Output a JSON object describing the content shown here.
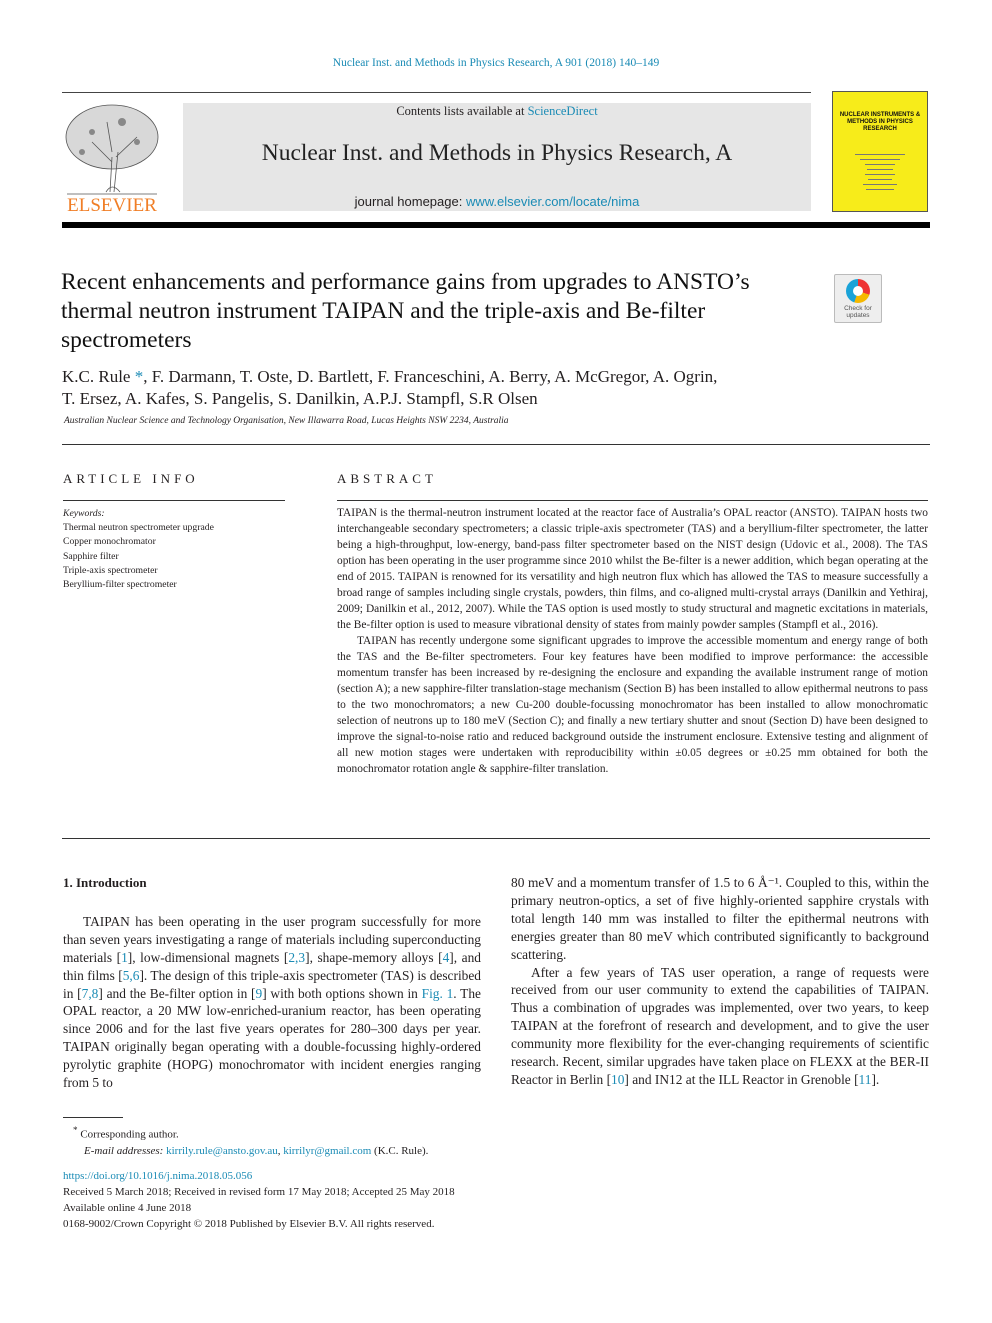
{
  "header": {
    "journal_ref": "Nuclear Inst. and Methods in Physics Research, A 901 (2018) 140–149",
    "contents_prefix": "Contents lists available at ",
    "contents_link": "ScienceDirect",
    "journal_title": "Nuclear Inst. and Methods in Physics Research, A",
    "homepage_prefix": "journal homepage: ",
    "homepage_link": "www.elsevier.com/locate/nima",
    "publisher_logo": "ELSEVIER",
    "cover_title": "NUCLEAR INSTRUMENTS & METHODS IN PHYSICS RESEARCH",
    "check_updates": "Check for updates"
  },
  "article": {
    "title": "Recent enhancements and performance gains from upgrades to ANSTO’s thermal neutron instrument TAIPAN and the triple-axis and Be-filter spectrometers",
    "authors_line1_a": "K.C. Rule ",
    "authors_star": "*",
    "authors_line1_b": ", F. Darmann, T. Oste, D. Bartlett, F. Franceschini, A. Berry, A. McGregor, A. Ogrin,",
    "authors_line2": "T. Ersez, A. Kafes, S. Pangelis, S. Danilkin, A.P.J. Stampfl, S.R Olsen",
    "affiliation": "Australian Nuclear Science and Technology Organisation, New Illawarra Road, Lucas Heights NSW 2234, Australia"
  },
  "article_info": {
    "heading": "ARTICLE INFO",
    "keywords_label": "Keywords:",
    "keywords": [
      "Thermal neutron spectrometer upgrade",
      "Copper monochromator",
      "Sapphire filter",
      "Triple-axis spectrometer",
      "Beryllium-filter spectrometer"
    ]
  },
  "abstract": {
    "heading": "ABSTRACT",
    "paragraphs": [
      "TAIPAN is the thermal-neutron instrument located at the reactor face of Australia’s OPAL reactor (ANSTO). TAIPAN hosts two interchangeable secondary spectrometers; a classic triple-axis spectrometer (TAS) and a beryllium-filter spectrometer, the latter being a high-throughput, low-energy, band-pass filter spectrometer based on the NIST design (Udovic et al., 2008). The TAS option has been operating in the user programme since 2010 whilst the Be-filter is a newer addition, which began operating at the end of 2015.  TAIPAN is renowned for its versatility and high neutron flux which has allowed the TAS to measure successfully a broad range of samples including single crystals, powders, thin films, and co-aligned multi-crystal arrays (Danilkin and Yethiraj, 2009; Danilkin et al., 2012, 2007). While the TAS option is used mostly to study structural and magnetic excitations in materials, the Be-filter option is used to measure vibrational density of states from mainly powder samples (Stampfl et al., 2016).",
      "TAIPAN has recently undergone some significant upgrades to improve the accessible momentum and energy range of both the TAS and the Be-filter spectrometers. Four key features have been modified to improve performance: the accessible momentum transfer has been increased by re-designing the enclosure and expanding the available instrument range of motion (section A); a new sapphire-filter translation-stage mechanism (Section B) has been installed to allow epithermal neutrons to pass to the two monochromators; a new Cu-200 double-focussing monochromator has been installed to allow monochromatic selection of neutrons up to 180 meV (Section C); and finally a new tertiary shutter and snout (Section D) have been designed to improve the signal-to-noise ratio and reduced background outside the instrument enclosure. Extensive testing and alignment of all new motion stages were undertaken with reproducibility within ±0.05 degrees or ±0.25 mm obtained for both the monochromator rotation angle & sapphire-filter translation."
    ]
  },
  "body": {
    "intro_heading": "1.  Introduction",
    "left_paragraphs": [
      [
        "TAIPAN has been operating in the user program successfully for more than seven years investigating a range of materials including superconducting materials [",
        {
          "link": "1"
        },
        "], low-dimensional magnets [",
        {
          "link": "2,3"
        },
        "], shape-memory alloys [",
        {
          "link": "4"
        },
        "], and thin films [",
        {
          "link": "5,6"
        },
        "]. The design of this triple-axis spectrometer (TAS) is described in [",
        {
          "link": "7,8"
        },
        "] and the Be-filter option in [",
        {
          "link": "9"
        },
        "] with both options shown in ",
        {
          "link": "Fig. 1"
        },
        ". The OPAL reactor, a 20 MW low-enriched-uranium reactor, has been operating since 2006 and for the last five years operates for 280–300 days per year. TAIPAN originally began operating with a double-focussing highly-ordered pyrolytic graphite (HOPG) monochromator with incident energies  ranging from 5 to"
      ]
    ],
    "right_paragraphs": [
      [
        "80 meV and a momentum transfer of 1.5 to 6 Å⁻¹. Coupled to this, within the primary neutron-optics, a set of five highly-oriented sapphire crystals with total length 140 mm was installed to filter the epithermal neutrons with energies greater than 80 meV which contributed significantly to background  scattering."
      ],
      [
        "After a few years of TAS user operation, a range of requests were received from our user community to extend the capabilities of TAIPAN. Thus a combination of upgrades was implemented, over two years, to keep TAIPAN at the forefront of research and development, and to give the user community more flexibility for the ever-changing requirements of scientific research. Recent, similar upgrades have taken place on FLEXX at the BER-II Reactor in Berlin [",
        {
          "link": "10"
        },
        "] and IN12 at the ILL Reactor in Grenoble [",
        {
          "link": "11"
        },
        "]."
      ]
    ]
  },
  "footnote": {
    "marker": "*",
    "corresponding": "Corresponding author.",
    "email_label": "E-mail addresses:",
    "email1": "kirrily.rule@ansto.gov.au",
    "email2": "kirrilyr@gmail.com",
    "email_suffix": " (K.C. Rule)."
  },
  "meta": {
    "doi": "https://doi.org/10.1016/j.nima.2018.05.056",
    "received": "Received 5 March 2018; Received in revised form 17 May 2018; Accepted 25 May 2018",
    "available": "Available online 4 June 2018",
    "copyright": "0168-9002/Crown Copyright © 2018 Published by Elsevier B.V. All rights reserved."
  },
  "colors": {
    "link": "#1a8bb5",
    "elsevier_orange": "#f07e26",
    "cover_yellow": "#f7ec1a"
  }
}
